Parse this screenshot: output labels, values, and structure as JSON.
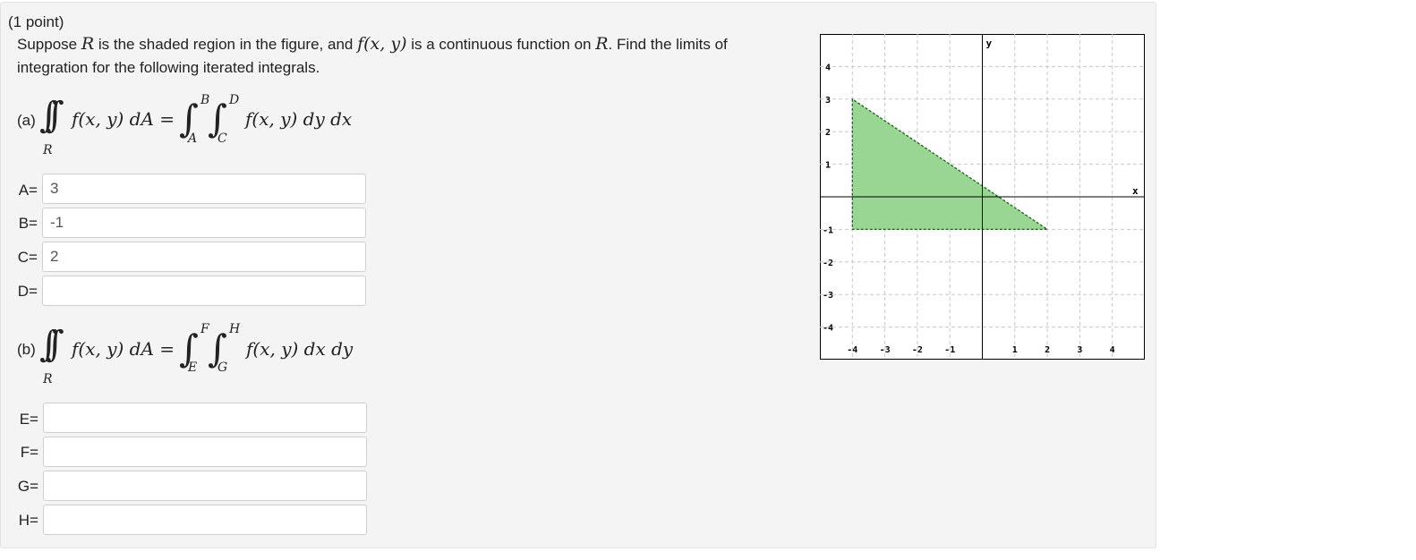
{
  "question": {
    "points": "(1 point)",
    "text_1": "Suppose ",
    "var_R": "R",
    "text_2": " is the shaded region in the figure, and ",
    "func": "f(x, y)",
    "text_3": " is a continuous function on ",
    "var_R2": "R",
    "text_4": ". Find the limits of",
    "text_line2": "integration for the following iterated integrals."
  },
  "part_a": {
    "label": "(a)",
    "integrand": "f(x, y) dA =",
    "region": "R",
    "outer_upper": "B",
    "outer_lower": "A",
    "inner_upper": "D",
    "inner_lower": "C",
    "rhs": "f(x, y) dy dx",
    "fields": [
      {
        "label": "A=",
        "value": "3"
      },
      {
        "label": "B=",
        "value": "-1"
      },
      {
        "label": "C=",
        "value": "2"
      },
      {
        "label": "D=",
        "value": ""
      }
    ]
  },
  "part_b": {
    "label": "(b)",
    "integrand": "f(x, y) dA =",
    "region": "R",
    "outer_upper": "F",
    "outer_lower": "E",
    "inner_upper": "H",
    "inner_lower": "G",
    "rhs": "f(x, y) dx dy",
    "fields": [
      {
        "label": "E=",
        "value": ""
      },
      {
        "label": "F=",
        "value": ""
      },
      {
        "label": "G=",
        "value": ""
      },
      {
        "label": "H=",
        "value": ""
      }
    ]
  },
  "graph": {
    "x_label": "x",
    "y_label": "y",
    "x_ticks": [
      "-4",
      "-3",
      "-2",
      "-1",
      "1",
      "2",
      "3",
      "4"
    ],
    "y_ticks": [
      "4",
      "3",
      "2",
      "1",
      "-1",
      "-2",
      "-3",
      "-4"
    ],
    "x_range": [
      -5,
      5
    ],
    "y_range": [
      -5,
      5
    ],
    "region_vertices": [
      [
        -4,
        3
      ],
      [
        -4,
        -1
      ],
      [
        2,
        -1
      ]
    ],
    "fill_color": "#99d593",
    "edge_color": "#1f5f1f"
  }
}
